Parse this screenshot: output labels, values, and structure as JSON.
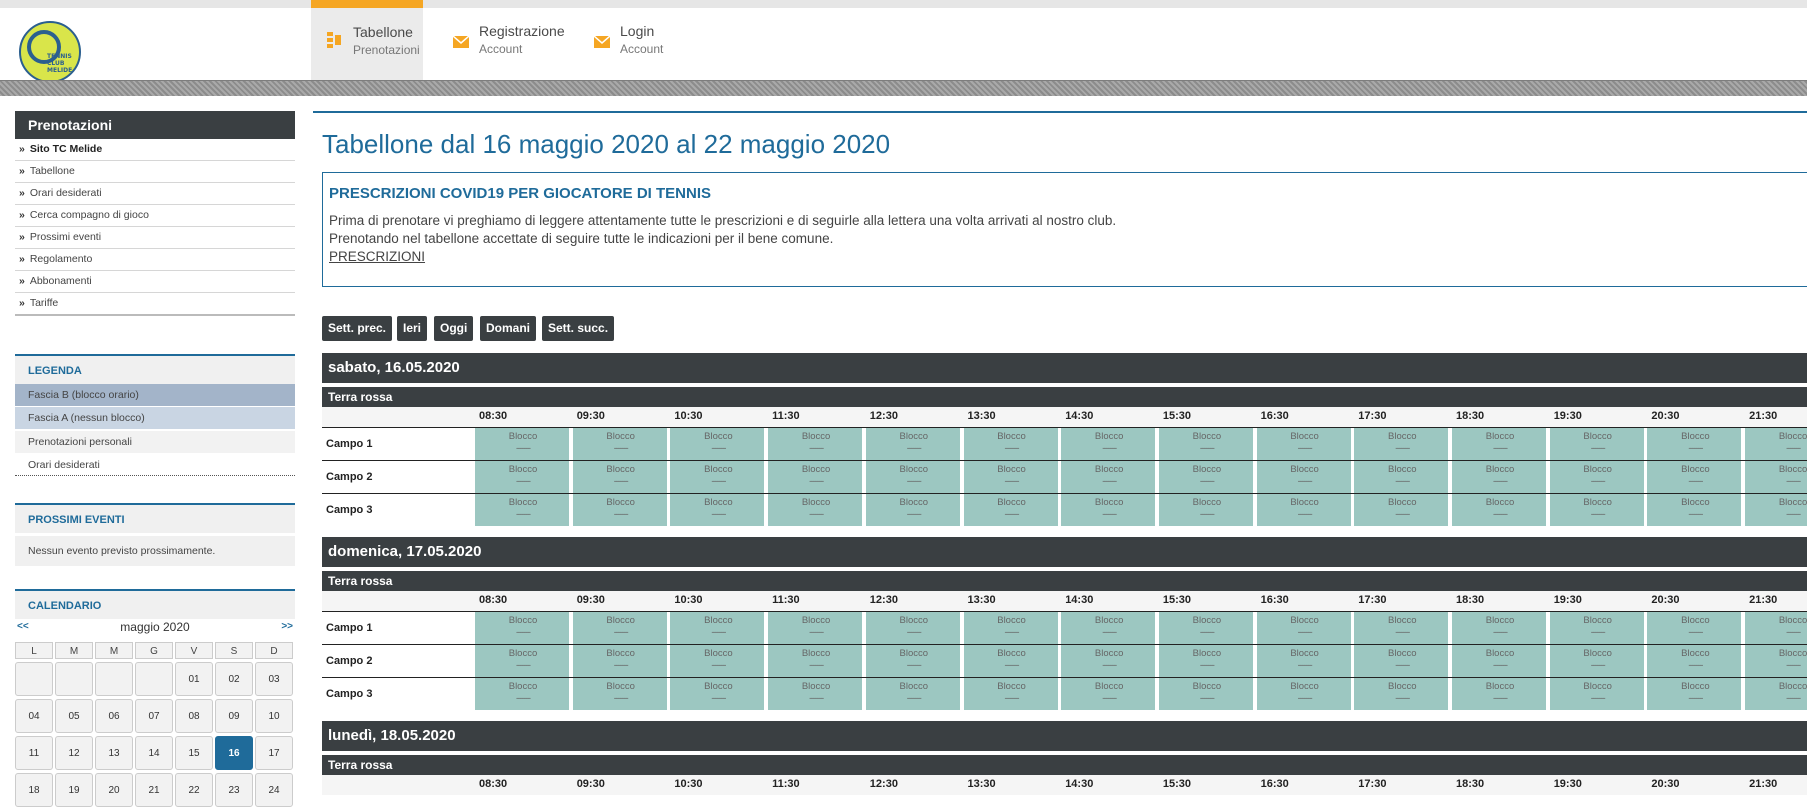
{
  "logo_text": [
    "TENNIS",
    "CLUB",
    "MELIDE"
  ],
  "nav": [
    {
      "title": "Tabellone",
      "sub": "Prenotazioni",
      "active": true
    },
    {
      "title": "Registrazione",
      "sub": "Account",
      "active": false
    },
    {
      "title": "Login",
      "sub": "Account",
      "active": false
    }
  ],
  "sidebar": {
    "menu_title": "Prenotazioni",
    "menu_items": [
      "Sito TC Melide",
      "Tabellone",
      "Orari desiderati",
      "Cerca compagno di gioco",
      "Prossimi eventi",
      "Regolamento",
      "Abbonamenti",
      "Tariffe"
    ],
    "legend_title": "LEGENDA",
    "legend_items": [
      {
        "label": "Fascia B (blocco orario)",
        "color": "#a3b4c9"
      },
      {
        "label": "Fascia A (nessun blocco)",
        "color": "#c9d5e3"
      },
      {
        "label": "Prenotazioni personali",
        "color": "#f2f2f2"
      },
      {
        "label": "Orari desiderati",
        "color": "#ffffff"
      }
    ],
    "events_title": "PROSSIMI EVENTI",
    "events_text": "Nessun evento previsto prossimamente.",
    "calendar_title": "CALENDARIO",
    "calendar": {
      "prev": "<<",
      "next": ">>",
      "month": "maggio 2020",
      "dow": [
        "L",
        "M",
        "M",
        "G",
        "V",
        "S",
        "D"
      ],
      "days": [
        "",
        "",
        "",
        "",
        "01",
        "02",
        "03",
        "04",
        "05",
        "06",
        "07",
        "08",
        "09",
        "10",
        "11",
        "12",
        "13",
        "14",
        "15",
        "16",
        "17",
        "18",
        "19",
        "20",
        "21",
        "22",
        "23",
        "24"
      ],
      "today": "16"
    }
  },
  "main": {
    "title": "Tabellone dal 16 maggio 2020 al 22 maggio 2020",
    "covid": {
      "title": "PRESCRIZIONI COVID19 PER GIOCATORE DI TENNIS",
      "line1": "Prima di prenotare vi preghiamo di leggere attentamente tutte le prescrizioni e di seguirle alla lettera una volta arrivati al nostro club.",
      "line2": "Prenotando nel tabellone accettate di seguire tutte le indicazioni per il bene comune.",
      "link": "PRESCRIZIONI"
    },
    "buttons": [
      "Sett. prec.",
      "Ieri",
      "Oggi",
      "Domani",
      "Sett. succ."
    ],
    "times": [
      "08:30",
      "09:30",
      "10:30",
      "11:30",
      "12:30",
      "13:30",
      "14:30",
      "15:30",
      "16:30",
      "17:30",
      "18:30",
      "19:30",
      "20:30",
      "21:30"
    ],
    "slot_label": "Blocco",
    "slot_line": "-------",
    "days": [
      {
        "label": "sabato, 16.05.2020",
        "surface": "Terra rossa",
        "courts": [
          "Campo 1",
          "Campo 2",
          "Campo 3"
        ]
      },
      {
        "label": "domenica, 17.05.2020",
        "surface": "Terra rossa",
        "courts": [
          "Campo 1",
          "Campo 2",
          "Campo 3"
        ]
      },
      {
        "label": "lunedì, 18.05.2020",
        "surface": "Terra rossa",
        "courts": []
      }
    ]
  }
}
